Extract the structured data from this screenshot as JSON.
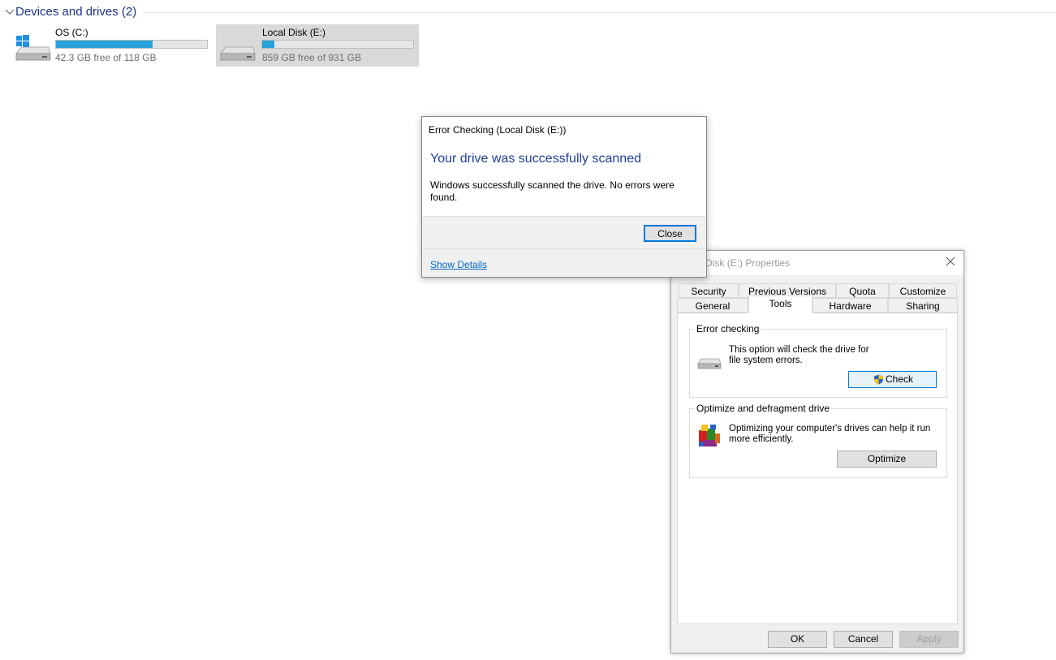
{
  "explorer": {
    "group_title": "Devices and drives (2)",
    "drives": [
      {
        "name": "OS (C:)",
        "free_text": "42.3 GB free of 118 GB",
        "used_fraction": 0.64,
        "selected": false
      },
      {
        "name": "Local Disk (E:)",
        "free_text": "859 GB free of 931 GB",
        "used_fraction": 0.08,
        "selected": true
      }
    ]
  },
  "properties_dialog": {
    "title": "Local Disk (E:) Properties",
    "tabs_row1": [
      "Security",
      "Previous Versions",
      "Quota",
      "Customize"
    ],
    "tabs_row2": [
      "General",
      "Tools",
      "Hardware",
      "Sharing"
    ],
    "active_tab": "Tools",
    "error_checking": {
      "label": "Error checking",
      "description": "This option will check the drive for file system errors.",
      "button": "Check"
    },
    "optimize": {
      "label": "Optimize and defragment drive",
      "description": "Optimizing your computer's drives can help it run more efficiently.",
      "button": "Optimize"
    },
    "buttons": {
      "ok": "OK",
      "cancel": "Cancel",
      "apply": "Apply"
    }
  },
  "error_dialog": {
    "title": "Error Checking (Local Disk (E:))",
    "heading": "Your drive was successfully scanned",
    "message": "Windows successfully scanned the drive. No errors were found.",
    "close_button": "Close",
    "details_link": "Show Details"
  },
  "colors": {
    "heading_blue": "#1e3f9b",
    "group_title_blue": "#1e3287",
    "usage_bar": "#26a0da",
    "focus_border": "#0078d7",
    "link": "#0066cc"
  }
}
